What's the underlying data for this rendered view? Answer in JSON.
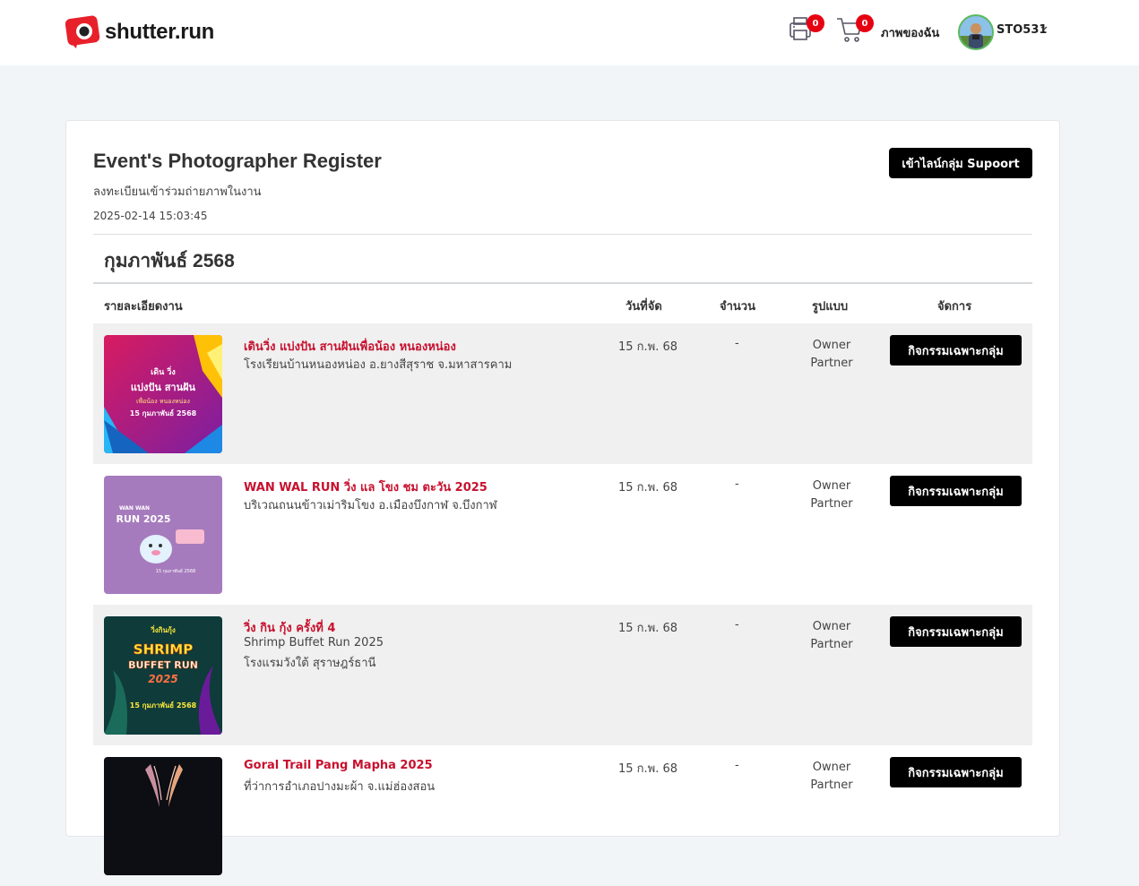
{
  "header": {
    "logo_text": "shutter.run",
    "print_badge": "0",
    "cart_badge": "0",
    "my_photos": "ภาพของฉัน",
    "username": "STO531",
    "icons": [
      "printer-icon",
      "cart-icon",
      "chevron-down-icon"
    ]
  },
  "page": {
    "title": "Event's Photographer Register",
    "subtitle": "ลงทะเบียนเข้าร่วมถ่ายภาพในงาน",
    "timestamp": "2025-02-14 15:03:45",
    "support_button": "เข้าไลน์กลุ่ม Supoort",
    "month": "กุมภาพันธ์ 2568"
  },
  "table": {
    "headers": {
      "detail": "รายละเอียดงาน",
      "date": "วันที่จัด",
      "count": "จำนวน",
      "type": "รูปแบบ",
      "manage": "จัดการ"
    },
    "rows": [
      {
        "title": "เดินวิ่ง แบ่งปัน สานฝันเพื่อน้อง หนองหน่อง",
        "lines": [
          "โรงเรียนบ้านหนองหน่อง อ.ยางสีสุราช จ.มหาสารคาม"
        ],
        "date": "15 ก.พ. 68",
        "count": "-",
        "type1": "Owner",
        "type2": "Partner",
        "button": "กิจกรรมเฉพาะกลุ่ม",
        "poster": {
          "top_label": "เดิน วิ่ง",
          "line1": "แบ่งปัน สานฝัน",
          "line2": "เพื่อน้อง หนองหน่อง",
          "date": "15 กุมภาพันธ์ 2568",
          "colors": [
            "#c2185b",
            "#8e24aa",
            "#ffc107"
          ]
        }
      },
      {
        "title": "WAN WAL RUN วิ่ง แล โขง ชม ตะวัน 2025",
        "lines": [
          "บริเวณถนนข้าวเม่าริมโขง อ.เมืองบึงกาฬ จ.บึงกาฬ"
        ],
        "date": "15 ก.พ. 68",
        "count": "-",
        "type1": "Owner",
        "type2": "Partner",
        "button": "กิจกรรมเฉพาะกลุ่ม",
        "poster": {
          "top_label": "WAN WAN",
          "line1": "RUN 2025",
          "line2": "",
          "date": "15 กุมภาพันธ์ 2568",
          "colors": [
            "#a67bbd",
            "#e91e63",
            "#ffffff"
          ]
        }
      },
      {
        "title": "วิ่ง กิน กุ้ง ครั้งที่ 4",
        "lines": [
          "Shrimp Buffet Run 2025",
          "โรงแรมวังใต้ สุราษฎร์ธานี"
        ],
        "date": "15 ก.พ. 68",
        "count": "-",
        "type1": "Owner",
        "type2": "Partner",
        "button": "กิจกรรมเฉพาะกลุ่ม",
        "poster": {
          "top_label": "วิ่งกินกุ้ง",
          "line1": "SHRIMP",
          "line2": "BUFFET RUN",
          "date": "15 กุมภาพันธ์ 2568",
          "colors": [
            "#0f3b3a",
            "#ff7043",
            "#ffeb3b"
          ]
        }
      },
      {
        "title": "Goral Trail Pang Mapha 2025",
        "lines": [
          "ที่ว่าการอำเภอปางมะผ้า จ.แม่ฮ่องสอน"
        ],
        "date": "15 ก.พ. 68",
        "count": "-",
        "type1": "Owner",
        "type2": "Partner",
        "button": "กิจกรรมเฉพาะกลุ่ม",
        "poster": {
          "top_label": "",
          "line1": "",
          "line2": "",
          "date": "",
          "colors": [
            "#0d0d14",
            "#c98fa0",
            "#e6a57e"
          ]
        }
      }
    ]
  }
}
